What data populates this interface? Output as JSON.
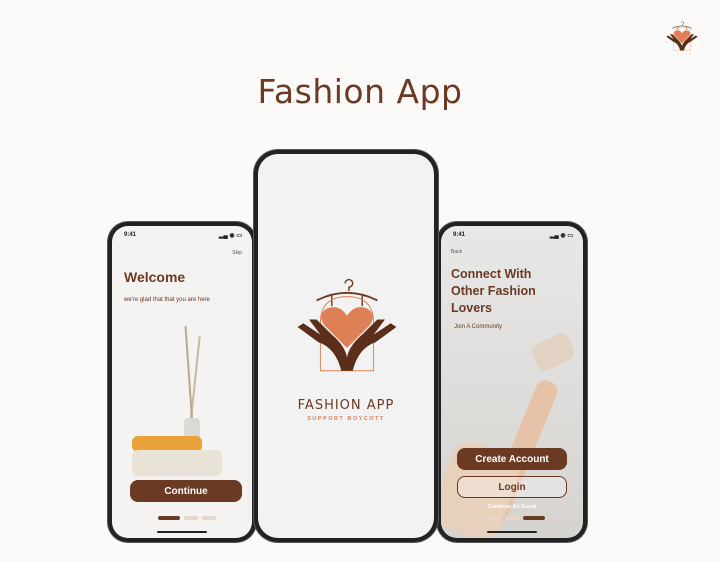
{
  "header": {
    "title": "Fashion App"
  },
  "brand": {
    "name": "FASHION APP",
    "tagline": "SUPPORT BOYCOTT",
    "accent": "#6b3a22",
    "heart": "#de7f55"
  },
  "welcome_screen": {
    "time": "9:41",
    "skip": "Skip",
    "heading": "Welcome",
    "subtitle": "we're glad that that you are here",
    "continue": "Continue",
    "page_index": 0,
    "page_count": 3
  },
  "splash_screen": {
    "logo_name": "FASHION APP",
    "logo_tagline": "SUPPORT BOYCOTT"
  },
  "connect_screen": {
    "time": "9:41",
    "back": "Back",
    "heading": "Connect With Other Fashion Lovers",
    "subtitle": "Join A Community",
    "create_account": "Create Account",
    "login": "Login",
    "guest": "Continue As Guest",
    "page_index": 2,
    "page_count": 3
  }
}
